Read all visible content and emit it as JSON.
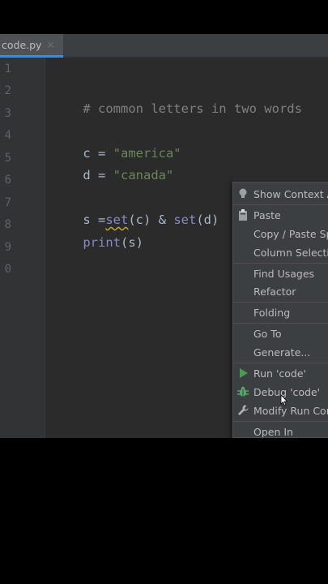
{
  "tab": {
    "filename": "code.py",
    "close_glyph": "×"
  },
  "line_numbers": [
    "1",
    "2",
    "3",
    "4",
    "5",
    "6",
    "7",
    "8",
    "9",
    "0"
  ],
  "code": {
    "comment": "# common letters in two words",
    "c_prefix": "c = ",
    "c_value": "\"america\"",
    "d_prefix": "d = ",
    "d_value": "\"canada\"",
    "s_prefix": "s =",
    "set_fn": "set",
    "s_mid": "(c) & ",
    "set_fn2": "set",
    "s_end": "(d)",
    "print_fn": "print",
    "print_args": "(s)"
  },
  "context_menu": {
    "items": [
      {
        "label": "Show Context Ac",
        "icon": "lightbulb-icon"
      },
      {
        "label": "Paste",
        "icon": "clipboard-icon"
      },
      {
        "label": "Copy / Paste Spe"
      },
      {
        "label": "Column Selectio"
      },
      {
        "label": "Find Usages"
      },
      {
        "label": "Refactor"
      },
      {
        "label": "Folding"
      },
      {
        "label": "Go To"
      },
      {
        "label": "Generate..."
      },
      {
        "label": "Run 'code'",
        "icon": "run-icon"
      },
      {
        "label": "Debug 'code'",
        "icon": "debug-icon"
      },
      {
        "label": "Modify Run Con",
        "icon": "wrench-icon"
      },
      {
        "label": "Open In"
      }
    ]
  },
  "colors": {
    "editor_bg": "#2b2b2b",
    "menu_bg": "#3c3f41",
    "string": "#6a8759",
    "comment": "#808080",
    "run_green": "#499c54",
    "debug_green": "#59a869"
  }
}
